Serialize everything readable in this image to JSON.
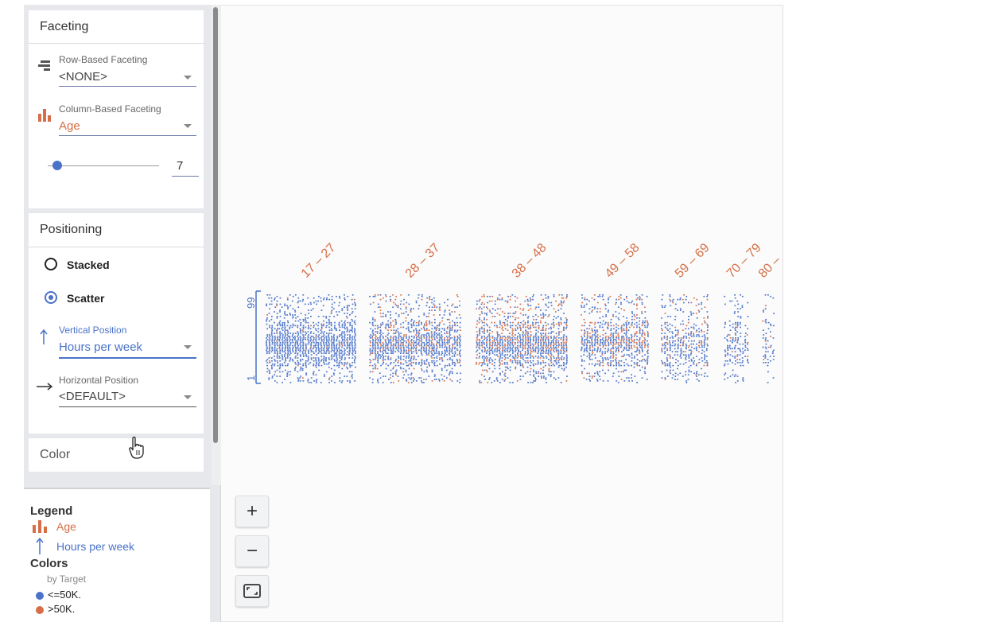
{
  "colors": {
    "blue": "#4a72c9",
    "orange": "#d66f47"
  },
  "faceting": {
    "title": "Faceting",
    "row": {
      "label": "Row-Based Faceting",
      "value": "<NONE>",
      "icon": "rows-icon"
    },
    "column": {
      "label": "Column-Based Faceting",
      "value": "Age",
      "icon": "bar-chart-icon"
    },
    "bins": "7"
  },
  "positioning": {
    "title": "Positioning",
    "options": [
      "Stacked",
      "Scatter"
    ],
    "selected": "Scatter",
    "vertical": {
      "label": "Vertical Position",
      "value": "Hours per week",
      "icon": "arrow-up-icon"
    },
    "horizontal": {
      "label": "Horizontal Position",
      "value": "<DEFAULT>",
      "icon": "arrow-right-icon"
    }
  },
  "color_section": {
    "title": "Color"
  },
  "legend": {
    "title": "Legend",
    "column_field": "Age",
    "row_field": "Hours per week",
    "colors_title": "Colors",
    "colors_by": "by Target",
    "classes": [
      {
        "label": "<=50K.",
        "color": "#4a72c9"
      },
      {
        "label": ">50K.",
        "color": "#d66f47"
      }
    ]
  },
  "zoom": {
    "in": "+",
    "out": "−"
  },
  "chart_data": {
    "type": "scatter",
    "facet_field": "Age",
    "y_field": "Hours per week",
    "y_ticks": [
      "1",
      "99"
    ],
    "facets": [
      {
        "label": "17 – 27",
        "density": 0.62,
        "orange_share": 0.03
      },
      {
        "label": "28 – 37",
        "density": 0.55,
        "orange_share": 0.22
      },
      {
        "label": "38 – 48",
        "density": 0.58,
        "orange_share": 0.3
      },
      {
        "label": "49 – 58",
        "density": 0.5,
        "orange_share": 0.28
      },
      {
        "label": "59 – 69",
        "density": 0.42,
        "orange_share": 0.2
      },
      {
        "label": "70 – 79",
        "density": 0.3,
        "orange_share": 0.1
      },
      {
        "label": "80 –",
        "density": 0.22,
        "orange_share": 0.05
      }
    ]
  }
}
